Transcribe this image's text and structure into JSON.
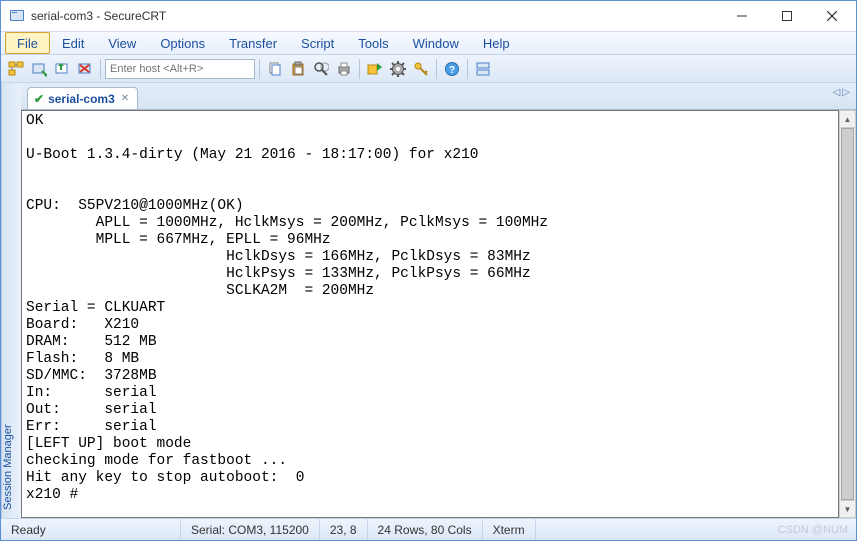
{
  "window": {
    "title": "serial-com3 - SecureCRT"
  },
  "menu": {
    "items": [
      "File",
      "Edit",
      "View",
      "Options",
      "Transfer",
      "Script",
      "Tools",
      "Window",
      "Help"
    ],
    "active_index": 0
  },
  "toolbar": {
    "host_placeholder": "Enter host <Alt+R>"
  },
  "side_panel": {
    "label": "Session Manager"
  },
  "tabs": {
    "items": [
      {
        "label": "serial-com3",
        "connected": true
      }
    ]
  },
  "terminal": {
    "lines": [
      "OK",
      "",
      "U-Boot 1.3.4-dirty (May 21 2016 - 18:17:00) for x210",
      "",
      "",
      "CPU:  S5PV210@1000MHz(OK)",
      "        APLL = 1000MHz, HclkMsys = 200MHz, PclkMsys = 100MHz",
      "        MPLL = 667MHz, EPLL = 96MHz",
      "                       HclkDsys = 166MHz, PclkDsys = 83MHz",
      "                       HclkPsys = 133MHz, PclkPsys = 66MHz",
      "                       SCLKA2M  = 200MHz",
      "Serial = CLKUART",
      "Board:   X210",
      "DRAM:    512 MB",
      "Flash:   8 MB",
      "SD/MMC:  3728MB",
      "In:      serial",
      "Out:     serial",
      "Err:     serial",
      "[LEFT UP] boot mode",
      "checking mode for fastboot ...",
      "Hit any key to stop autoboot:  0",
      "x210 #"
    ]
  },
  "status": {
    "ready": "Ready",
    "serial": "Serial: COM3, 115200",
    "cursor": "23,  8",
    "dims": "24 Rows, 80 Cols",
    "emu": "Xterm",
    "watermark": "CSDN @NUM"
  }
}
